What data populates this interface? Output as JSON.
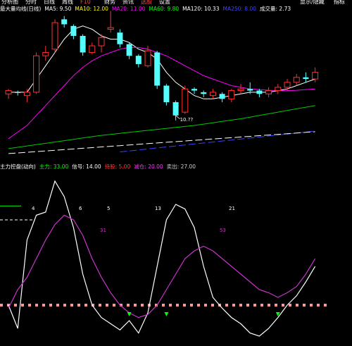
{
  "topbar": {
    "items": [
      {
        "label": "分析图",
        "color": "#ffffff"
      },
      {
        "label": "分时",
        "color": "#ffffff"
      },
      {
        "label": "日线",
        "color": "#ffffff"
      },
      {
        "label": "周线",
        "color": "#ffffff"
      },
      {
        "label": "F10",
        "color": "#ff4040"
      },
      {
        "label": "财务",
        "color": "#ffffff"
      },
      {
        "label": "资讯",
        "color": "#ffffff"
      },
      {
        "label": "选股",
        "color": "#ff4040"
      },
      {
        "label": "设置",
        "color": "#ffffff"
      }
    ],
    "right_items": [
      {
        "label": "显示/隐藏",
        "color": "#ffffff"
      },
      {
        "label": "指标",
        "color": "#ffffff"
      }
    ]
  },
  "colors": {
    "background": "#000000",
    "up_candle": "#ff3232",
    "down_candle": "#54ffff",
    "ma5": "#ffffff",
    "ma10": "#ffff00",
    "ma20": "#ff00ff",
    "ma60": "#00cc00",
    "ma120": "#4040ff",
    "ma250": "#ffffff",
    "ind_main": "#ffffff",
    "ind_signal": "#cc33cc",
    "ind_level": "#ff9999",
    "arrow": "#00ff00"
  },
  "chart_data": [
    {
      "type": "candlestick",
      "title": "",
      "legend": [
        {
          "label": "最大量均线(日线)",
          "color": "#ffffff"
        },
        {
          "label": "MA5: 9.50",
          "color": "#ffffff"
        },
        {
          "label": "MA10: 12.00",
          "color": "#ffff00"
        },
        {
          "label": "MA20: 11.00",
          "color": "#ff00ff"
        },
        {
          "label": "MA60: 9.80",
          "color": "#00ff00"
        },
        {
          "label": "MA120: 10.33",
          "color": "#ffffff"
        },
        {
          "label": "MA250: 8.00",
          "color": "#4040ff"
        },
        {
          "label": "成交量: 2.73",
          "color": "#ffffff"
        }
      ],
      "ylim": [
        9.0,
        13.4
      ],
      "candles": [
        [
          10.95,
          11.1,
          10.8,
          11.05
        ],
        [
          11.0,
          11.05,
          10.9,
          10.98
        ],
        [
          10.9,
          11.1,
          10.7,
          11.0
        ],
        [
          11.0,
          12.2,
          10.95,
          12.1
        ],
        [
          12.1,
          12.4,
          11.95,
          12.2
        ],
        [
          12.3,
          13.2,
          12.2,
          13.1
        ],
        [
          13.2,
          13.3,
          12.95,
          13.05
        ],
        [
          13.0,
          13.05,
          12.6,
          12.7
        ],
        [
          12.7,
          12.75,
          12.1,
          12.2
        ],
        [
          12.2,
          12.5,
          12.15,
          12.4
        ],
        [
          12.4,
          12.75,
          12.2,
          12.65
        ],
        [
          12.9,
          13.45,
          12.8,
          12.95
        ],
        [
          12.8,
          12.9,
          12.35,
          12.45
        ],
        [
          12.45,
          12.5,
          12.0,
          12.1
        ],
        [
          12.1,
          12.15,
          11.75,
          11.85
        ],
        [
          11.8,
          12.4,
          11.75,
          12.25
        ],
        [
          12.2,
          12.25,
          11.1,
          11.2
        ],
        [
          11.2,
          11.25,
          10.6,
          10.7
        ],
        [
          10.7,
          10.75,
          10.15,
          10.3
        ],
        [
          10.4,
          11.2,
          10.35,
          11.1
        ],
        [
          11.1,
          11.15,
          10.95,
          11.05
        ],
        [
          11.0,
          11.05,
          10.85,
          10.95
        ],
        [
          10.9,
          11.1,
          10.8,
          11.0
        ],
        [
          10.95,
          11.0,
          10.7,
          10.8
        ],
        [
          10.8,
          11.1,
          10.7,
          11.05
        ],
        [
          11.05,
          11.25,
          10.95,
          11.1
        ],
        [
          11.1,
          11.3,
          10.95,
          11.05
        ],
        [
          11.05,
          11.1,
          10.85,
          10.95
        ],
        [
          10.95,
          11.15,
          10.85,
          11.05
        ],
        [
          11.05,
          11.25,
          10.95,
          11.15
        ],
        [
          11.15,
          11.4,
          11.05,
          11.3
        ],
        [
          11.3,
          11.55,
          11.2,
          11.45
        ],
        [
          11.45,
          11.6,
          11.3,
          11.4
        ],
        [
          11.4,
          11.75,
          11.3,
          11.6
        ]
      ],
      "annotations": [
        {
          "label": "10.??",
          "candle": 18,
          "price": 10.3,
          "color": "#ffffff"
        }
      ],
      "series": [
        {
          "name": "MA5",
          "color": "#ffffff",
          "values": [
            11.0,
            11.0,
            11.0,
            11.4,
            11.8,
            12.2,
            12.6,
            12.9,
            13.0,
            12.9,
            12.7,
            12.6,
            12.6,
            12.5,
            12.3,
            12.2,
            12.0,
            11.6,
            11.3,
            11.1,
            10.9,
            10.8,
            10.8,
            10.85,
            10.9,
            10.95,
            11.0,
            11.0,
            11.0,
            11.05,
            11.1,
            11.2,
            11.3,
            11.4
          ]
        },
        {
          "name": "MA20",
          "color": "#ff00ff",
          "values": [
            9.6,
            9.8,
            10.0,
            10.3,
            10.6,
            10.9,
            11.2,
            11.5,
            11.75,
            11.95,
            12.1,
            12.2,
            12.3,
            12.35,
            12.35,
            12.3,
            12.2,
            12.1,
            11.95,
            11.8,
            11.65,
            11.5,
            11.4,
            11.3,
            11.2,
            11.15,
            11.1,
            11.08,
            11.06,
            11.05,
            11.05,
            11.06,
            11.08,
            11.1
          ]
        },
        {
          "name": "MA60",
          "color": "#00cc00",
          "values": [
            9.3,
            9.34,
            9.38,
            9.42,
            9.46,
            9.5,
            9.54,
            9.58,
            9.62,
            9.66,
            9.7,
            9.73,
            9.76,
            9.79,
            9.82,
            9.85,
            9.88,
            9.91,
            9.94,
            9.97,
            10.0,
            10.04,
            10.08,
            10.12,
            10.16,
            10.2,
            10.25,
            10.3,
            10.35,
            10.4,
            10.45,
            10.5,
            10.55,
            10.6
          ]
        },
        {
          "name": "MA120",
          "color": "#4040ff",
          "values": [
            null,
            null,
            null,
            null,
            null,
            null,
            null,
            null,
            null,
            null,
            null,
            null,
            9.2,
            9.23,
            9.26,
            9.29,
            9.32,
            9.35,
            9.38,
            9.41,
            9.44,
            9.47,
            9.5,
            9.53,
            9.56,
            9.59,
            9.62,
            9.65,
            9.68,
            9.71,
            9.74,
            9.77,
            9.8,
            9.83
          ]
        },
        {
          "name": "MA250",
          "color": "#ffffff",
          "values": [
            9.15,
            9.17,
            9.19,
            9.21,
            9.23,
            9.25,
            9.27,
            9.29,
            9.31,
            9.33,
            9.35,
            9.37,
            9.39,
            9.41,
            9.43,
            9.45,
            9.47,
            9.49,
            9.51,
            9.53,
            9.55,
            9.57,
            9.59,
            9.61,
            9.63,
            9.65,
            9.67,
            9.69,
            9.71,
            9.73,
            9.75,
            9.77,
            9.79,
            9.81
          ]
        }
      ]
    },
    {
      "type": "line",
      "title": "",
      "legend": [
        {
          "label": "主力控盘(动向)",
          "color": "#ffffff"
        },
        {
          "label": "主力: 33.00",
          "color": "#00ff00"
        },
        {
          "label": "信号: 14.00",
          "color": "#ffffff"
        },
        {
          "label": "持股: 5.00",
          "color": "#ff3333"
        },
        {
          "label": "减仓: 20.00",
          "color": "#ff33ff"
        },
        {
          "label": "卖出: 27.00",
          "color": "#cccccc"
        }
      ],
      "ylim": [
        -5,
        105
      ],
      "level_value": 20,
      "series": [
        {
          "name": "主力",
          "color": "#ffffff",
          "values": [
            20,
            5,
            62,
            78,
            80,
            100,
            90,
            70,
            40,
            20,
            12,
            8,
            4,
            10,
            2,
            15,
            45,
            75,
            85,
            82,
            70,
            45,
            25,
            18,
            12,
            8,
            2,
            0,
            5,
            12,
            20,
            26,
            35,
            45
          ]
        },
        {
          "name": "信号",
          "color": "#cc33cc",
          "values": [
            18,
            30,
            38,
            50,
            62,
            72,
            78,
            75,
            65,
            50,
            38,
            28,
            20,
            15,
            12,
            14,
            20,
            30,
            40,
            50,
            55,
            58,
            55,
            50,
            45,
            40,
            35,
            30,
            28,
            25,
            28,
            32,
            40,
            50
          ]
        }
      ],
      "labels": [
        {
          "text": "4",
          "color": "#ffffff"
        },
        {
          "text": "6",
          "color": "#ffffff"
        },
        {
          "text": "5",
          "color": "#ffffff"
        },
        {
          "text": "13",
          "color": "#ffffff"
        },
        {
          "text": "21",
          "color": "#ffffff"
        },
        {
          "text": "31",
          "color": "#cc33cc"
        },
        {
          "text": "53",
          "color": "#cc33cc"
        }
      ],
      "arrows": [
        {
          "candle": 13,
          "color": "#00ff00"
        },
        {
          "candle": 17,
          "color": "#00ff00"
        },
        {
          "candle": 29,
          "color": "#00ff00"
        }
      ]
    }
  ]
}
